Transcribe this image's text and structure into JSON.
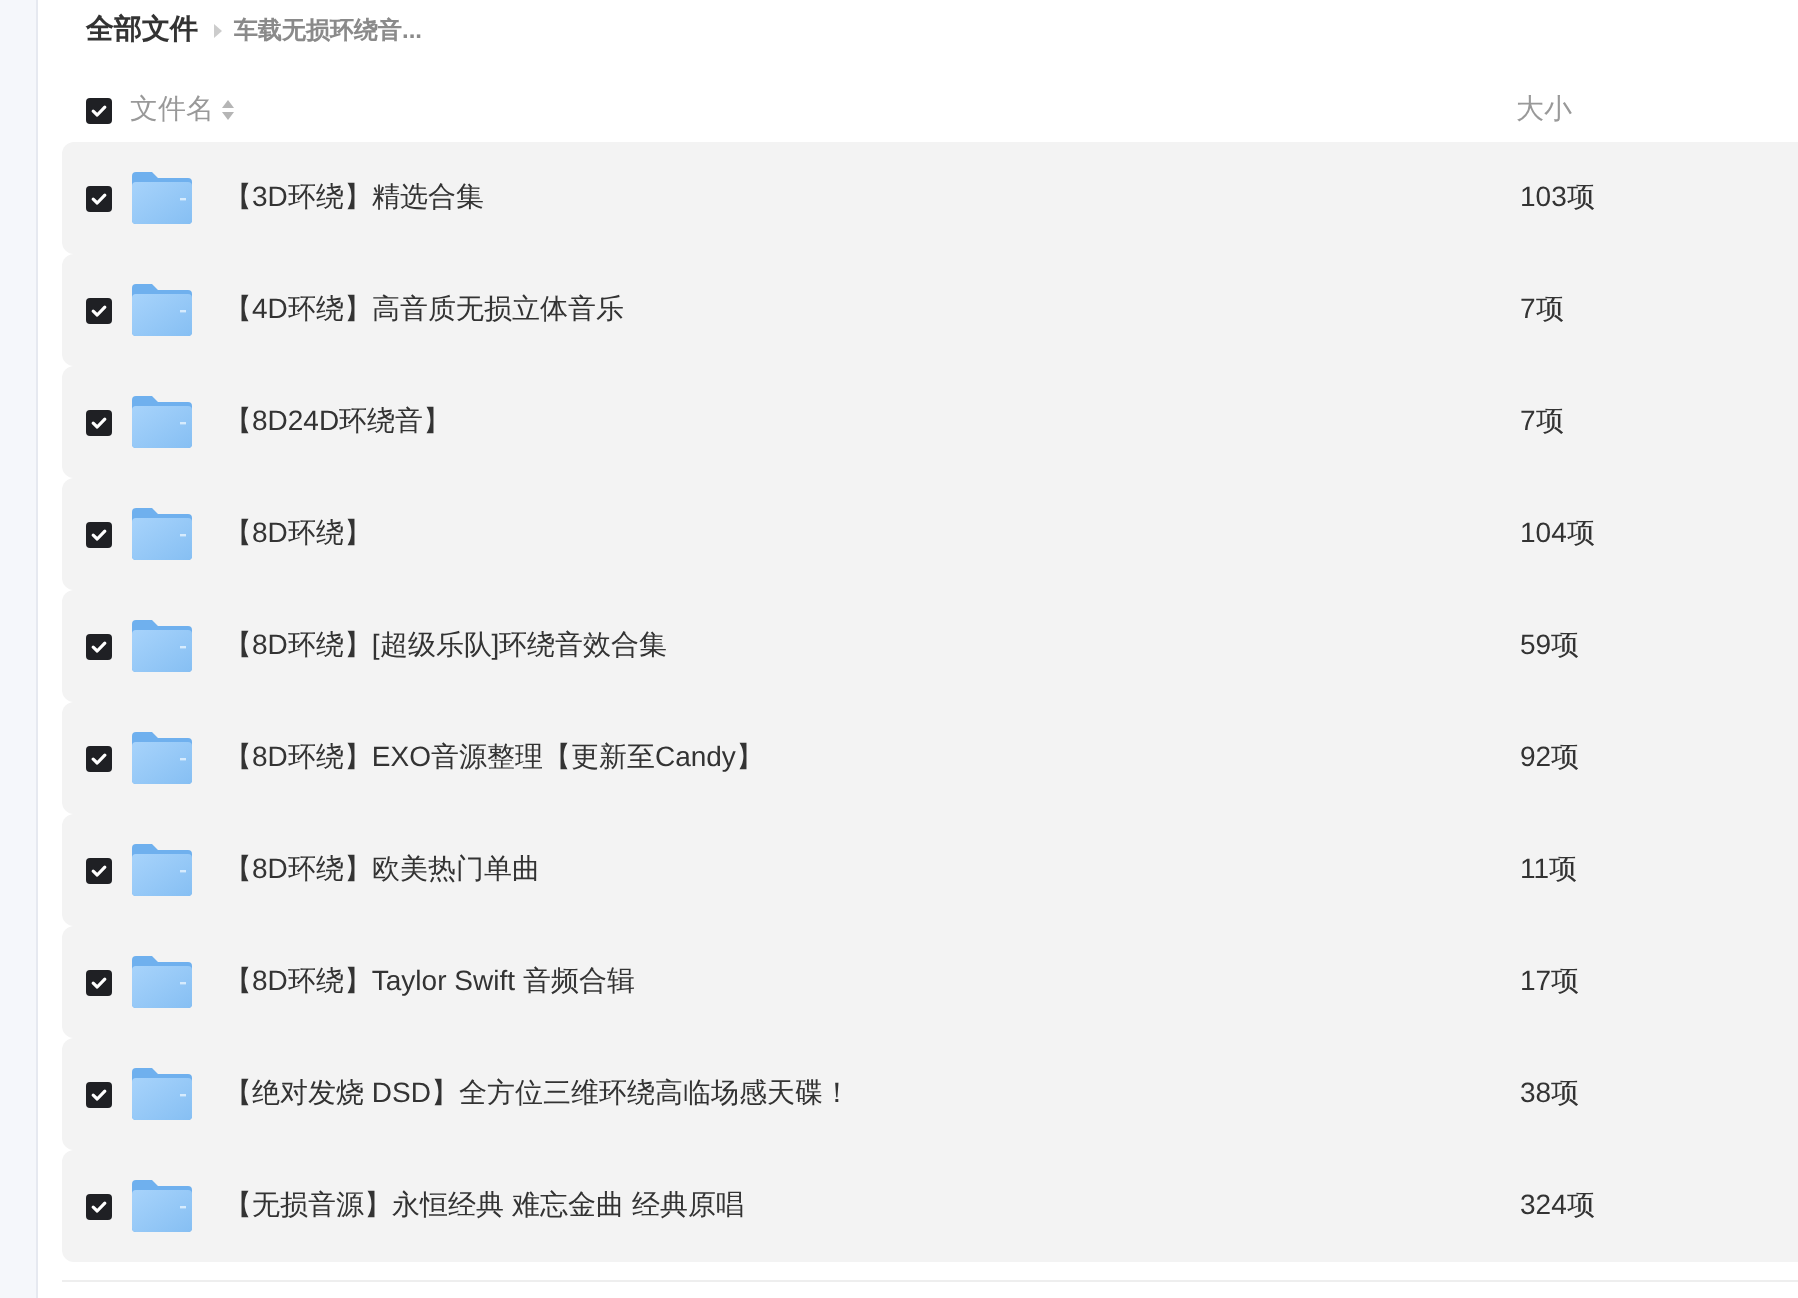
{
  "breadcrumb": {
    "root": "全部文件",
    "current": "车载无损环绕音..."
  },
  "header": {
    "checked": true,
    "columns": [
      {
        "label": "文件名",
        "sortable": true
      },
      {
        "label": "大小",
        "sortable": false
      }
    ]
  },
  "rows": [
    {
      "name": "【3D环绕】精选合集",
      "size": "103项",
      "checked": true
    },
    {
      "name": "【4D环绕】高音质无损立体音乐",
      "size": "7项",
      "checked": true
    },
    {
      "name": "【8D24D环绕音】",
      "size": "7项",
      "checked": true
    },
    {
      "name": "【8D环绕】",
      "size": "104项",
      "checked": true
    },
    {
      "name": "【8D环绕】[超级乐队]环绕音效合集",
      "size": "59项",
      "checked": true
    },
    {
      "name": "【8D环绕】EXO音源整理【更新至Candy】",
      "size": "92项",
      "checked": true
    },
    {
      "name": "【8D环绕】欧美热门单曲",
      "size": "11项",
      "checked": true
    },
    {
      "name": "【8D环绕】Taylor Swift 音频合辑",
      "size": "17项",
      "checked": true
    },
    {
      "name": "【绝对发烧 DSD】全方位三维环绕高临场感天碟！",
      "size": "38项",
      "checked": true
    },
    {
      "name": "【无损音源】永恒经典 难忘金曲 经典原唱",
      "size": "324项",
      "checked": true
    }
  ]
}
